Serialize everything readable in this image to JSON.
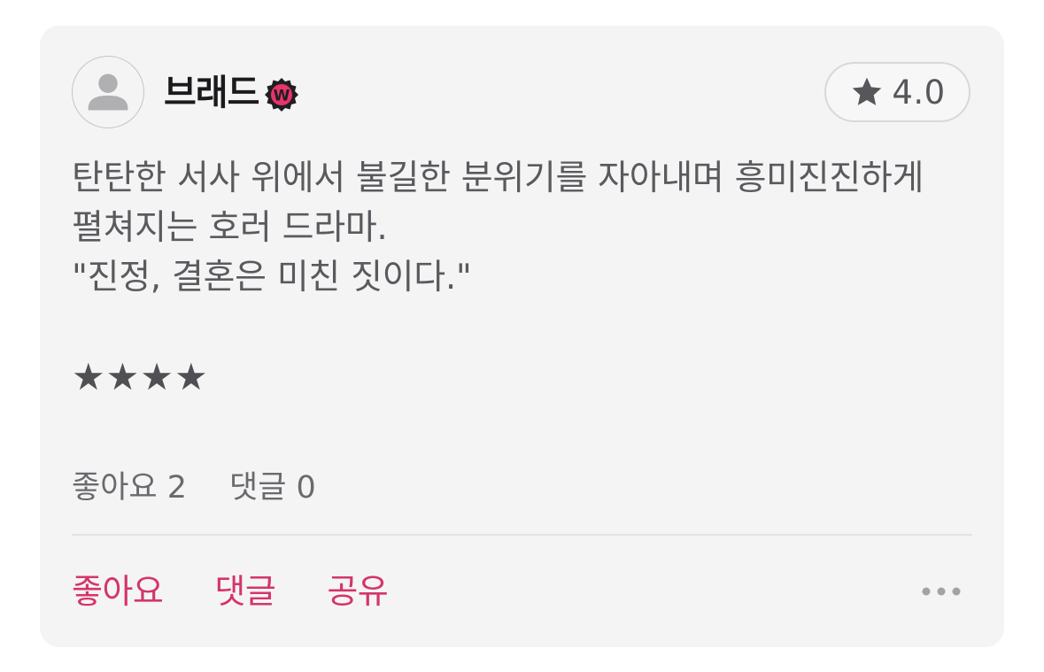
{
  "review": {
    "username": "브래드",
    "rating": "4.0",
    "text_lines": [
      "탄탄한 서사 위에서 불길한 분위기를 자아내며 흥미진진하게",
      "펼쳐지는 호러 드라마.",
      "\"진정, 결혼은 미친 짓이다.\""
    ],
    "stars": "★★★★",
    "likes_stat": "좋아요 2",
    "comments_stat": "댓글 0"
  },
  "actions": {
    "like_label": "좋아요",
    "comment_label": "댓글",
    "share_label": "공유"
  },
  "icons": {
    "avatar": "person-placeholder-icon",
    "badge": "verified-w-badge-icon",
    "rating": "star-icon",
    "more": "more-dots-icon",
    "badge_letter": "W"
  },
  "colors": {
    "accent": "#d4356a",
    "card_bg": "#f4f4f5",
    "badge_bg": "#1f1f22"
  }
}
